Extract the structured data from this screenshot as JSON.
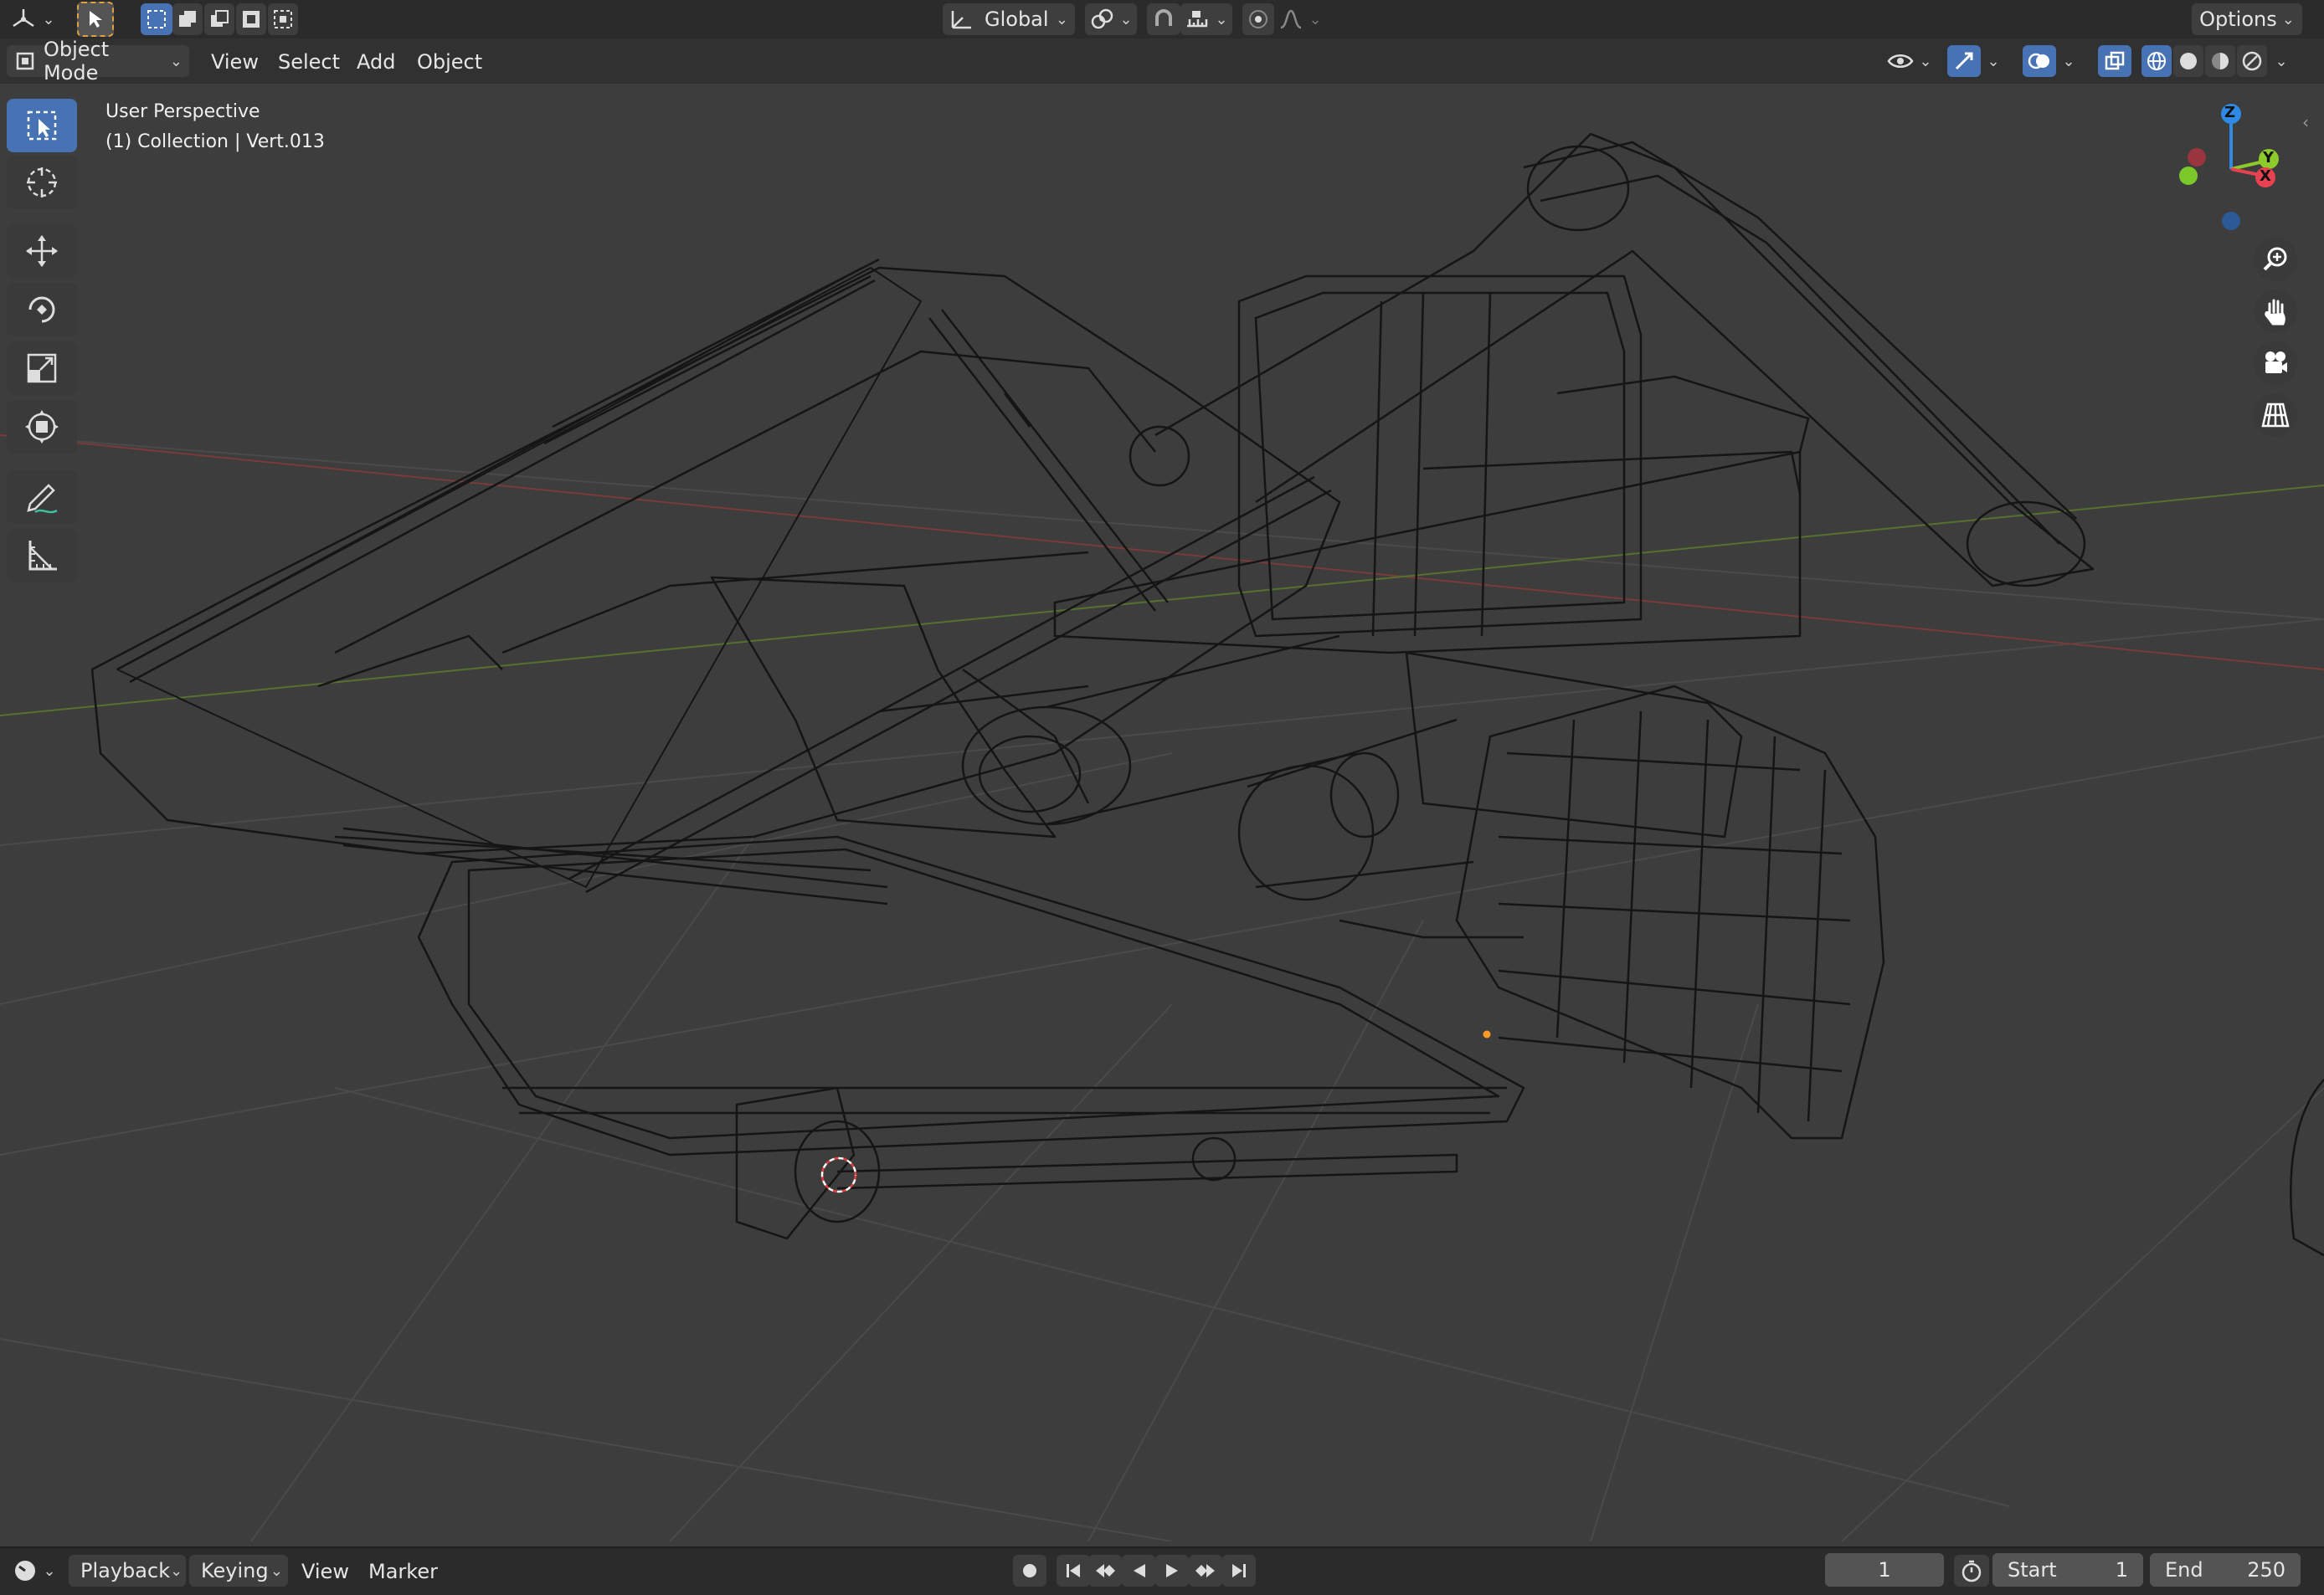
{
  "top_bar": {
    "transform_orientation": "Global",
    "options_label": "Options"
  },
  "header": {
    "mode_label": "Object Mode",
    "menus": [
      "View",
      "Select",
      "Add",
      "Object"
    ]
  },
  "viewport": {
    "view_name": "User Perspective",
    "collection_info": "(1) Collection | Vert.013",
    "gizmo_axes": {
      "z": "Z",
      "y": "Y",
      "x": "X"
    }
  },
  "toolbar": {
    "tools": [
      "select-box",
      "cursor",
      "move",
      "rotate",
      "scale",
      "transform",
      "annotate",
      "measure"
    ]
  },
  "timeline": {
    "menus": [
      "Playback",
      "Keying",
      "View",
      "Marker"
    ],
    "current_frame": "1",
    "start_label": "Start",
    "start_value": "1",
    "end_label": "End",
    "end_value": "250"
  },
  "colors": {
    "accent": "#4772b3",
    "x_axis": "#e8414f",
    "y_axis": "#8ccb2a",
    "z_axis": "#2e8ae6"
  }
}
